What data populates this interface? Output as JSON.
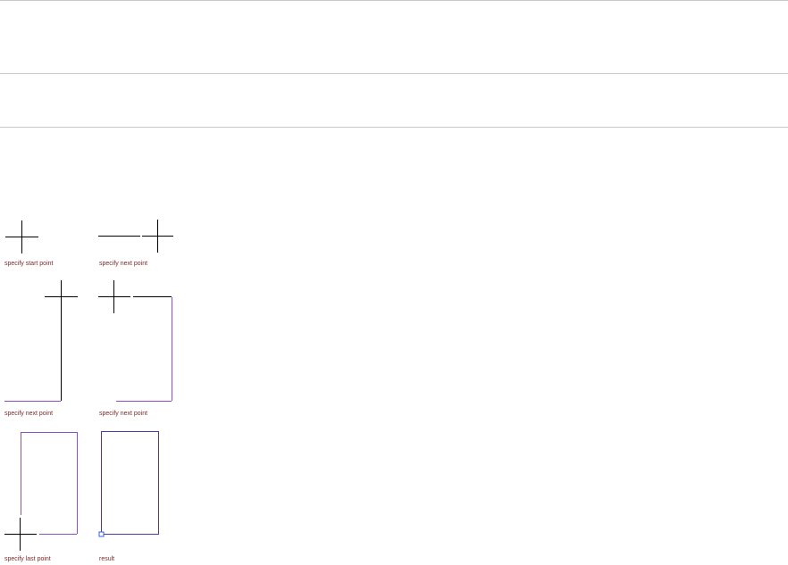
{
  "colors": {
    "cursor": "#000000",
    "drawn_line": "#8a4fc4",
    "result_line": "#4a3aa8",
    "grip": "#2f5fe0",
    "label": "#7a2a2a",
    "rule": "#c8c8c8"
  },
  "steps": [
    {
      "label": "specify start point"
    },
    {
      "label": "specify next point"
    },
    {
      "label": "specify next point"
    },
    {
      "label": "specify next point"
    },
    {
      "label": "specify last point"
    },
    {
      "label": "result"
    }
  ]
}
